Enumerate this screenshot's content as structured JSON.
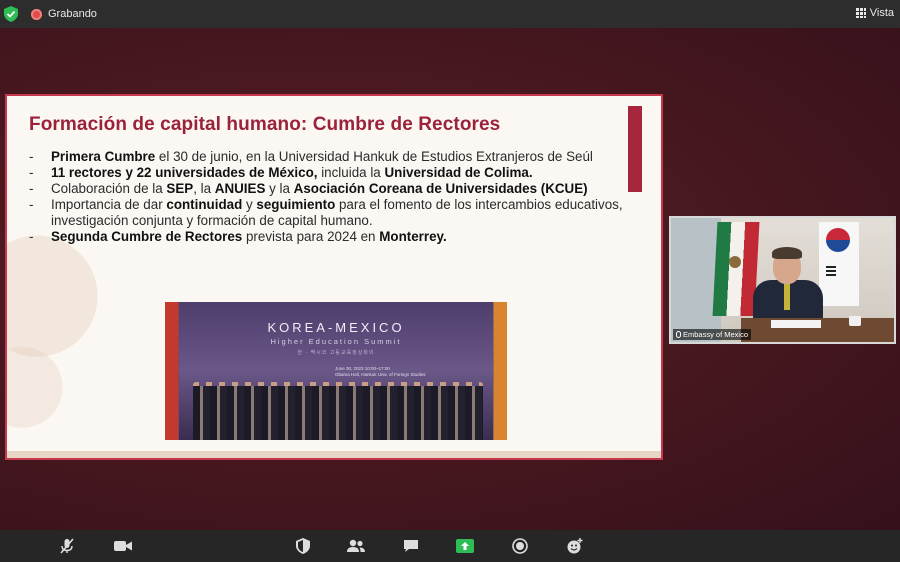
{
  "topbar": {
    "recording_label": "Grabando",
    "view_label": "Vista"
  },
  "slide": {
    "title": "Formación de capital humano: Cumbre de Rectores",
    "bullets": [
      {
        "parts": [
          {
            "b": true,
            "t": "Primera Cumbre"
          },
          {
            "b": false,
            "t": " el 30 de junio, en la Universidad Hankuk de Estudios Extranjeros de Seúl"
          }
        ]
      },
      {
        "parts": [
          {
            "b": true,
            "t": "11 rectores y 22 universidades de México,"
          },
          {
            "b": false,
            "t": " incluida la "
          },
          {
            "b": true,
            "t": "Universidad de Colima."
          }
        ]
      },
      {
        "parts": [
          {
            "b": false,
            "t": "Colaboración de la "
          },
          {
            "b": true,
            "t": "SEP"
          },
          {
            "b": false,
            "t": ", la "
          },
          {
            "b": true,
            "t": "ANUIES"
          },
          {
            "b": false,
            "t": " y la "
          },
          {
            "b": true,
            "t": "Asociación Coreana de Universidades (KCUE)"
          }
        ]
      },
      {
        "parts": [
          {
            "b": false,
            "t": "Importancia de dar "
          },
          {
            "b": true,
            "t": "continuidad"
          },
          {
            "b": false,
            "t": " y "
          },
          {
            "b": true,
            "t": "seguimiento"
          },
          {
            "b": false,
            "t": " para el fomento de los intercambios educativos, investigación conjunta y formación de capital humano."
          }
        ]
      },
      {
        "parts": [
          {
            "b": true,
            "t": "Segunda Cumbre de Rectores"
          },
          {
            "b": false,
            "t": " prevista para 2024 en "
          },
          {
            "b": true,
            "t": "Monterrey."
          }
        ]
      }
    ],
    "photo": {
      "banner_title": "KOREA-MEXICO",
      "banner_subtitle": "Higher Education Summit",
      "banner_korean": "한 · 멕시코 고등교육정상회의",
      "banner_date": "June 30, 2023 10:00~17:00",
      "banner_venue": "Obama Hall, Hankuk Univ. of Foreign Studies"
    }
  },
  "video": {
    "participant_name": "Embassy of Mexico"
  },
  "toolbar": {
    "icons": [
      "mic-muted-icon",
      "video-camera-icon",
      "security-icon",
      "participants-icon",
      "chat-icon",
      "share-screen-icon",
      "record-icon",
      "reactions-icon"
    ]
  },
  "colors": {
    "accent": "#9b2239",
    "background": "#4a1a22",
    "toolbar": "#262626",
    "share_green": "#2ebd54"
  }
}
